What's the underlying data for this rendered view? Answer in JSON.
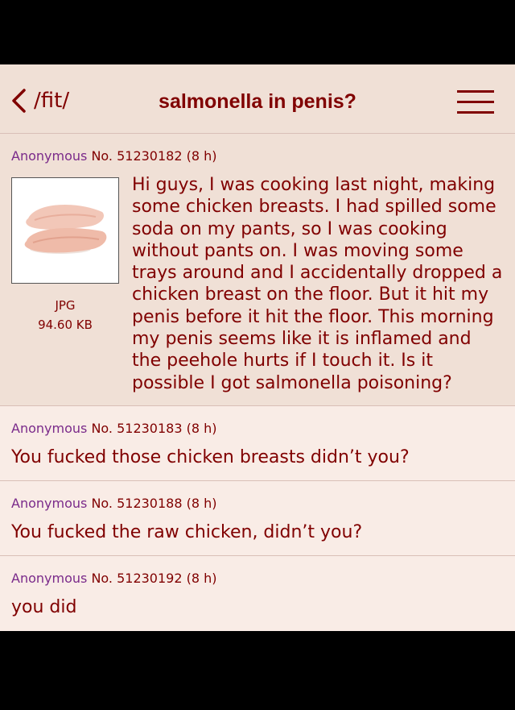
{
  "header": {
    "board": "/fit/",
    "title": "salmonella in penis?"
  },
  "op": {
    "name": "Anonymous",
    "number": "No. 51230182",
    "age": "(8 h)",
    "file_type": "JPG",
    "file_size": "94.60 KB",
    "text": "Hi guys, I was cooking last night, making some chicken breasts. I had spilled some soda on my pants, so I was cooking without pants on. I was moving some trays around and I accidentally dropped a chicken breast on the floor. But it hit my penis before it hit the floor. This morning my penis seems like it is inflamed and the peehole hurts if I touch it. Is it possible I got salmonella poisoning?"
  },
  "replies": [
    {
      "name": "Anonymous",
      "number": "No. 51230183",
      "age": "(8 h)",
      "text": "You fucked those chicken breasts didn’t you?"
    },
    {
      "name": "Anonymous",
      "number": "No. 51230188",
      "age": "(8 h)",
      "text": "You fucked the raw chicken, didn’t you?"
    },
    {
      "name": "Anonymous",
      "number": "No. 51230192",
      "age": "(8 h)",
      "text": "you did"
    }
  ]
}
